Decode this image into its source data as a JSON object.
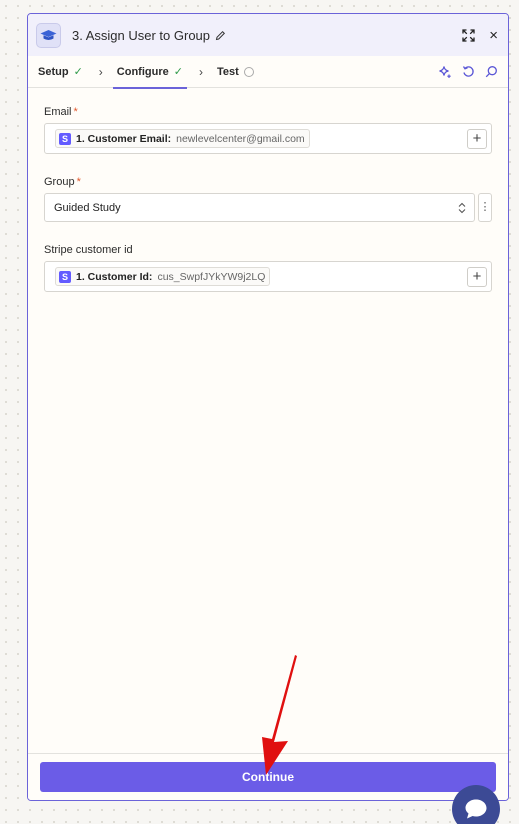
{
  "header": {
    "title": "3. Assign User to Group",
    "icons": [
      "graduation-cap-icon",
      "pencil-icon",
      "expand-icon",
      "close-icon"
    ],
    "close_glyph": "×"
  },
  "steps": [
    {
      "label": "Setup",
      "status": "complete"
    },
    {
      "label": "Configure",
      "status": "complete"
    },
    {
      "label": "Test",
      "status": "pending"
    }
  ],
  "fields": {
    "email": {
      "label": "Email",
      "required_mark": "*",
      "pill_icon": "S",
      "pill_key": "1. Customer Email:",
      "pill_value": "newlevelcenter@gmail.com"
    },
    "group": {
      "label": "Group",
      "required_mark": "*",
      "selected": "Guided Study"
    },
    "stripe_customer_id": {
      "label": "Stripe customer id",
      "pill_icon": "S",
      "pill_key": "1. Customer Id:",
      "pill_value": "cus_SwpfJYkYW9j2LQ"
    }
  },
  "footer": {
    "continue_label": "Continue"
  },
  "colors": {
    "accent": "#6b5ce7",
    "panel_border": "#6b63d9",
    "stripe": "#635bff",
    "check": "#2f9a4a",
    "required": "#e2582c",
    "annotation_arrow": "#e01010"
  }
}
